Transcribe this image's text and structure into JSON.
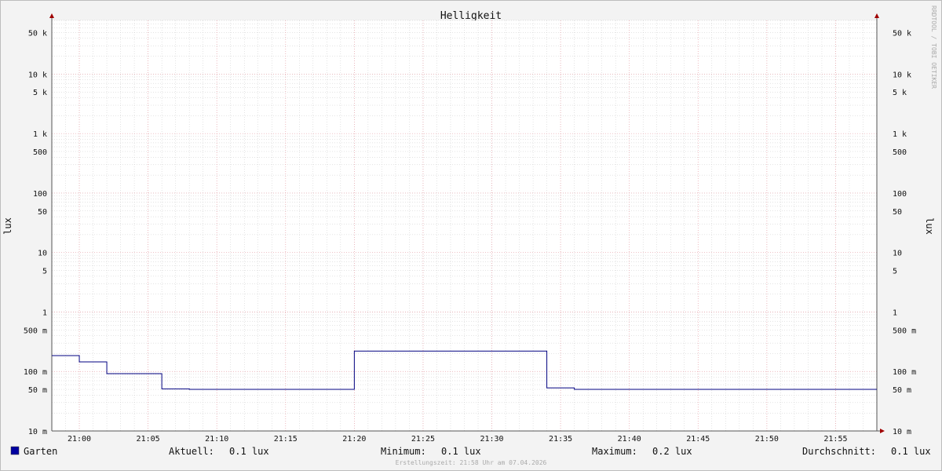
{
  "chart_data": {
    "type": "line",
    "title": "Helligkeit",
    "ylabel": "lux",
    "ylabel_right": "lux",
    "y_scale": "log",
    "ylim": [
      10,
      100000
    ],
    "y_ticks": [
      {
        "value": 10,
        "label": "10 m"
      },
      {
        "value": 50,
        "label": "50 m"
      },
      {
        "value": 100,
        "label": "100 m"
      },
      {
        "value": 500,
        "label": "500 m"
      },
      {
        "value": 1000,
        "label": "1"
      },
      {
        "value": 5000,
        "label": "5"
      },
      {
        "value": 10000,
        "label": "10"
      },
      {
        "value": 50000,
        "label": "50"
      },
      {
        "value": 100000,
        "label": "100"
      },
      {
        "value": 500000,
        "label": "500"
      },
      {
        "value": 1000000,
        "label": "1 k"
      },
      {
        "value": 5000000,
        "label": "5 k"
      },
      {
        "value": 10000000,
        "label": "10 k"
      },
      {
        "value": 50000000,
        "label": "50 k"
      }
    ],
    "y_range": [
      10,
      80000000
    ],
    "x_range": [
      "20:58",
      "21:58"
    ],
    "x_ticks": [
      "21:00",
      "21:05",
      "21:10",
      "21:15",
      "21:20",
      "21:25",
      "21:30",
      "21:35",
      "21:40",
      "21:45",
      "21:50",
      "21:55"
    ],
    "grid": true,
    "series": [
      {
        "name": "Garten",
        "color": "#000080",
        "x": [
          "20:58",
          "21:00",
          "21:02",
          "21:06",
          "21:08",
          "21:20",
          "21:34",
          "21:36",
          "21:58"
        ],
        "y": [
          185,
          145,
          92,
          51,
          50,
          220,
          53,
          50,
          50
        ]
      }
    ],
    "legend": {
      "position": "bottom-left",
      "swatch_color": "#0000a0",
      "label": "Garten",
      "stats": [
        {
          "label": "Aktuell:",
          "value": "0.1 lux"
        },
        {
          "label": "Minimum:",
          "value": "0.1 lux"
        },
        {
          "label": "Maximum:",
          "value": "0.2 lux"
        },
        {
          "label": "Durchschnitt:",
          "value": "0.1 lux"
        }
      ]
    },
    "footer": "Erstellungszeit: 21:58 Uhr am 07.04.2026",
    "watermark": "RRDTOOL / TOBI OETIKER"
  },
  "colors": {
    "background": "#f3f3f3",
    "plot_background": "#ffffff",
    "major_grid": "#e8a0a8",
    "minor_grid": "#c8c8c8",
    "axis": "#555555",
    "arrow": "#a00000",
    "text": "#111111",
    "muted": "#aaaaaa"
  }
}
